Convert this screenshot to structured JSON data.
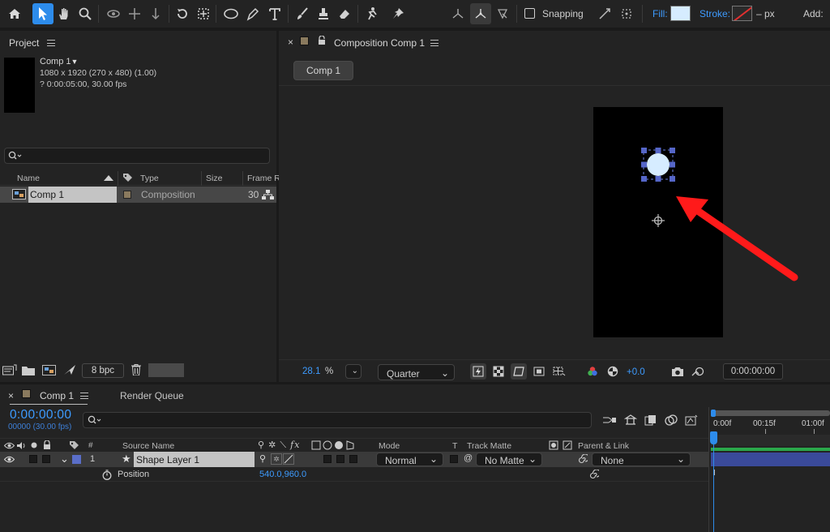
{
  "toolbar": {
    "snapping_label": "Snapping",
    "fill_label": "Fill:",
    "stroke_label": "Stroke:",
    "stroke_unit": "– px",
    "add_label": "Add:",
    "fill_color": "#d6ecff",
    "accent": "#2d8ceb"
  },
  "project": {
    "title": "Project",
    "comp_name": "Comp 1",
    "comp_dims": "1080 x 1920  (270 x 480) (1.00)",
    "comp_duration": "? 0:00:05:00, 30.00 fps",
    "search_placeholder": "",
    "columns": {
      "name": "Name",
      "type": "Type",
      "size": "Size",
      "frame_rate": "Frame R"
    },
    "rows": [
      {
        "name": "Comp 1",
        "type": "Composition",
        "frame_rate": "30"
      }
    ],
    "bpc_label": "8 bpc"
  },
  "composition": {
    "tab_label": "Composition Comp 1",
    "breadcrumb": "Comp 1",
    "zoom_value": "28.1",
    "zoom_unit": "%",
    "resolution": "Quarter",
    "exposure": "+0.0",
    "timecode": "0:00:00:00"
  },
  "timeline": {
    "tab_comp": "Comp 1",
    "tab_render": "Render Queue",
    "timecode": "0:00:00:00",
    "frame_info": "00000 (30.00 fps)",
    "ruler": [
      "0:00f",
      "00:15f",
      "01:00f"
    ],
    "headers": {
      "num": "#",
      "source_name": "Source Name",
      "mode": "Mode",
      "t": "T",
      "track_matte": "Track Matte",
      "parent_link": "Parent & Link"
    },
    "layer": {
      "number": "1",
      "name": "Shape Layer 1",
      "mode": "Normal",
      "matte": "No Matte",
      "parent": "None",
      "label_color": "#5a6ec8"
    },
    "property": {
      "name": "Position",
      "value": "540.0,960.0"
    },
    "playhead_color": "#2d8ceb",
    "work_area_color": "#2aa84a",
    "layer_bar_color": "#3a4a9a"
  },
  "annotation": {
    "arrow_color": "#ff1a1a"
  }
}
